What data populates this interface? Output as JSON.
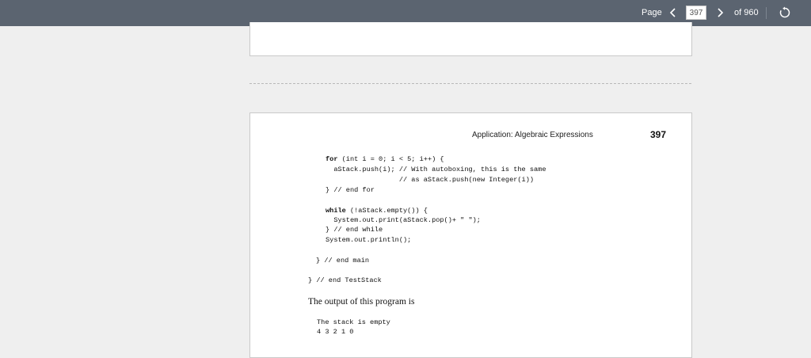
{
  "toolbar": {
    "page_label": "Page",
    "current_page": "397",
    "total_pages_label": "of 960",
    "prev_icon": "chevron-left-icon",
    "next_icon": "chevron-right-icon",
    "rotate_icon": "rotate-icon"
  },
  "page": {
    "running_head": "Application: Algebraic Expressions",
    "page_number": "397",
    "code_lines": [
      {
        "kw": "for",
        "rest": " (int i = 0; i < 5; i++) {",
        "kw2": "int"
      },
      {
        "text": "  aStack.push(i); // With autoboxing, this is the same"
      },
      {
        "text": "                  // as aStack.push(new Integer(i))"
      },
      {
        "text": "} // end for"
      },
      {
        "kw": "while",
        "rest": " (!aStack.empty()) {"
      },
      {
        "text": "  System.out.print(aStack.pop()+ \" \");"
      },
      {
        "text": "} // end while"
      },
      {
        "text": "System.out.println();"
      },
      {
        "text": "} // end main"
      },
      {
        "text": "} // end TestStack"
      }
    ],
    "output_intro": "The output of this program is",
    "output_lines": [
      "The stack is empty",
      "4 3 2 1 0"
    ]
  }
}
